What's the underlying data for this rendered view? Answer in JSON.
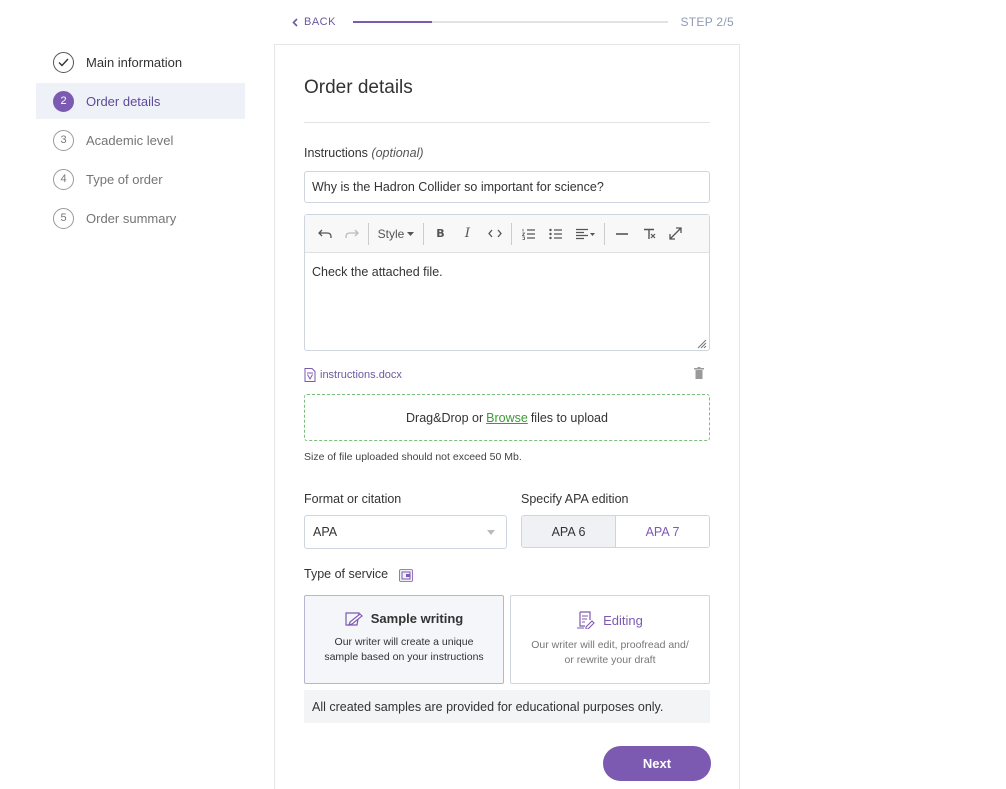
{
  "header": {
    "back_label": "BACK",
    "step_label": "STEP 2/5",
    "progress": 0.25
  },
  "sidebar": {
    "items": [
      {
        "number": "",
        "label": "Main information",
        "state": "done",
        "icon": "checkmark-icon"
      },
      {
        "number": "2",
        "label": "Order details",
        "state": "active"
      },
      {
        "number": "3",
        "label": "Academic level",
        "state": "pending"
      },
      {
        "number": "4",
        "label": "Type of order",
        "state": "pending"
      },
      {
        "number": "5",
        "label": "Order summary",
        "state": "pending"
      }
    ]
  },
  "form": {
    "title": "Order details",
    "instructions_label": "Instructions",
    "instructions_optional": "(optional)",
    "instructions_value": "Why is the Hadron Collider so important for science?",
    "editor": {
      "style_label": "Style",
      "content": "Check the attached file."
    },
    "attachment": {
      "file_name": "instructions.docx"
    },
    "upload": {
      "text_before": "Drag&Drop or",
      "browse_label": "Browse",
      "text_after": "files to upload",
      "note": "Size of file uploaded should not exceed 50 Mb."
    },
    "format": {
      "label": "Format or citation",
      "selected": "APA"
    },
    "apa_edition": {
      "label": "Specify APA edition",
      "options": [
        "APA 6",
        "APA 7"
      ],
      "selected": "APA 6"
    },
    "service": {
      "label": "Type of service",
      "options": [
        {
          "title": "Sample writing",
          "description": "Our writer will create a unique sample based on your instructions",
          "selected": true
        },
        {
          "title": "Editing",
          "description": "Our writer will edit, proofread and/ or rewrite your draft",
          "selected": false
        }
      ]
    },
    "disclaimer": "All created samples are provided for educational purposes only.",
    "next_label": "Next"
  },
  "colors": {
    "accent": "#7d5ab1",
    "success": "#3d9a3a",
    "active_bg": "#eef2f8"
  }
}
